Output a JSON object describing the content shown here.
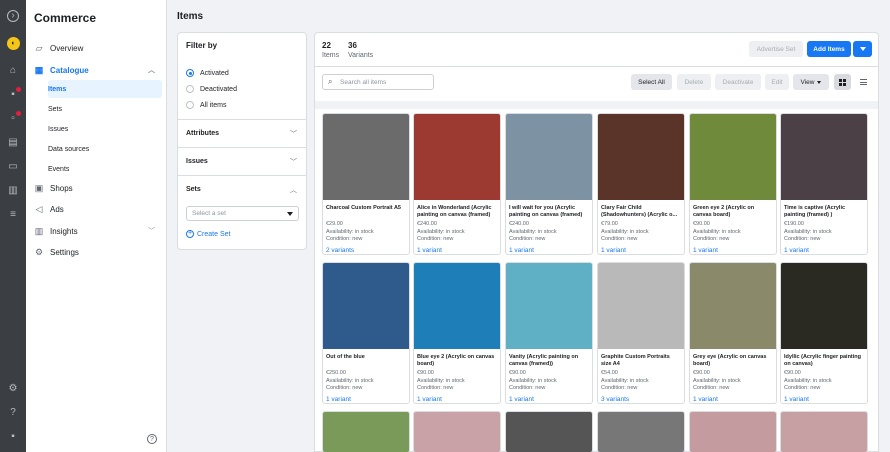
{
  "sidebar": {
    "title": "Commerce",
    "items": [
      {
        "label": "Overview",
        "icon": "overview-icon"
      },
      {
        "label": "Catalogue",
        "icon": "catalogue-icon"
      },
      {
        "label": "Shops",
        "icon": "shop-icon"
      },
      {
        "label": "Ads",
        "icon": "ads-icon"
      },
      {
        "label": "Insights",
        "icon": "insights-icon"
      },
      {
        "label": "Settings",
        "icon": "settings-icon"
      }
    ],
    "catalogue_sub": [
      "Items",
      "Sets",
      "Issues",
      "Data sources",
      "Events"
    ]
  },
  "page": {
    "title": "Items"
  },
  "filter": {
    "title": "Filter by",
    "options": [
      "Activated",
      "Deactivated",
      "All items"
    ],
    "selected": "Activated",
    "sections": [
      "Attributes",
      "Issues",
      "Sets"
    ],
    "set_placeholder": "Select a set",
    "create_set": "Create Set"
  },
  "stats": {
    "items_count": "22",
    "items_label": "Items",
    "variants_count": "36",
    "variants_label": "Variants"
  },
  "toolbar": {
    "advertise_set": "Advertise Set",
    "add_items": "Add Items",
    "search_placeholder": "Search all items",
    "select_all": "Select All",
    "delete": "Delete",
    "deactivate": "Deactivate",
    "edit": "Edit",
    "view": "View"
  },
  "colors": {
    "accent": "#1877f2"
  },
  "products": [
    {
      "title": "Charcoal Custom Portrait A5",
      "price": "€29.00",
      "availability": "Availability: in stock",
      "condition": "Condition: new",
      "variants": "2 variants",
      "img": "#6b6b6b"
    },
    {
      "title": "Alice in Wonderland (Acrylic painting on canvas (framed)",
      "price": "€240.00",
      "availability": "Availability: in stock",
      "condition": "Condition: new",
      "variants": "1 variant",
      "img": "#9c3a32"
    },
    {
      "title": "I will wait for you (Acrylic painting on canvas (framed)",
      "price": "€240.00",
      "availability": "Availability: in stock",
      "condition": "Condition: new",
      "variants": "1 variant",
      "img": "#7d93a3"
    },
    {
      "title": "Clary Fair Child (Shadowhunters) (Acrylic o...",
      "price": "€79.00",
      "availability": "Availability: in stock",
      "condition": "Condition: new",
      "variants": "1 variant",
      "img": "#5a3428"
    },
    {
      "title": "Green eye 2 (Acrylic on canvas board)",
      "price": "€90.00",
      "availability": "Availability: in stock",
      "condition": "Condition: new",
      "variants": "1 variant",
      "img": "#6f8a3a"
    },
    {
      "title": "Time is captive (Acrylic painting (framed) )",
      "price": "€190.00",
      "availability": "Availability: in stock",
      "condition": "Condition: new",
      "variants": "1 variant",
      "img": "#4a4046"
    },
    {
      "title": "Out of the blue",
      "price": "€250.00",
      "availability": "Availability: in stock",
      "condition": "Condition: new",
      "variants": "1 variant",
      "img": "#2f5a8c"
    },
    {
      "title": "Blue eye 2 (Acrylic on canvas board)",
      "price": "€90.00",
      "availability": "Availability: in stock",
      "condition": "Condition: new",
      "variants": "1 variant",
      "img": "#1e7fb8"
    },
    {
      "title": "Vanity (Acrylic painting on canvas (framed))",
      "price": "€90.00",
      "availability": "Availability: in stock",
      "condition": "Condition: new",
      "variants": "1 variant",
      "img": "#5fb0c4"
    },
    {
      "title": "Graphite Custom Portraits size A4",
      "price": "€54.00",
      "availability": "Availability: in stock",
      "condition": "Condition: new",
      "variants": "3 variants",
      "img": "#b9b9b9"
    },
    {
      "title": "Grey eye (Acrylic on canvas board)",
      "price": "€90.00",
      "availability": "Availability: in stock",
      "condition": "Condition: new",
      "variants": "1 variant",
      "img": "#8a8a6a"
    },
    {
      "title": "Idyllic (Acrylic finger painting on canvas)",
      "price": "€90.00",
      "availability": "Availability: in stock",
      "condition": "Condition: new",
      "variants": "1 variant",
      "img": "#2a2a22"
    },
    {
      "img": "#7a9a5a"
    },
    {
      "img": "#c9a2a8"
    },
    {
      "img": "#555555"
    },
    {
      "img": "#777777"
    },
    {
      "img": "#c49ca0"
    },
    {
      "img": "#c7a0a4"
    }
  ]
}
